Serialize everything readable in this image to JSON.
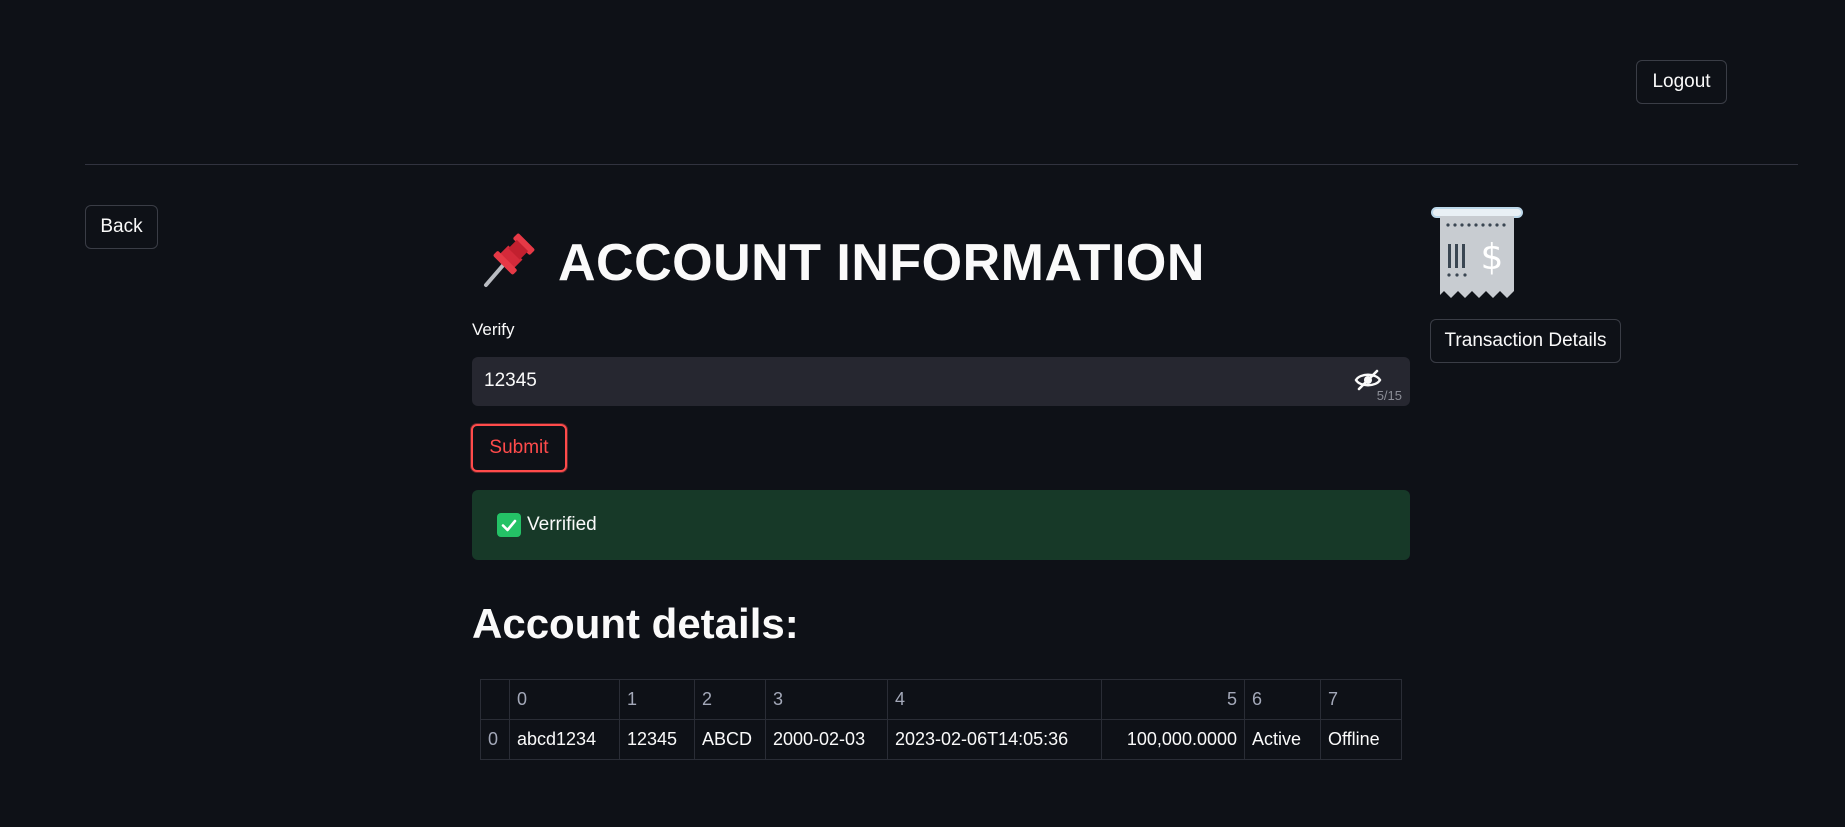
{
  "header": {
    "logout_label": "Logout"
  },
  "nav": {
    "back_label": "Back"
  },
  "page": {
    "title_icon": "pushpin-icon",
    "title": "ACCOUNT INFORMATION"
  },
  "sidebar_right": {
    "receipt_icon": "receipt-icon",
    "transaction_label": "Transaction Details"
  },
  "verify": {
    "label": "Verify",
    "value": "12345",
    "char_count": "5/15",
    "toggle_icon": "eye-slash-icon"
  },
  "submit_label": "Submit",
  "alert": {
    "icon": "check-box-icon",
    "text": "Verrified",
    "color": "#173928"
  },
  "details": {
    "heading": "Account details:",
    "columns": [
      "",
      "0",
      "1",
      "2",
      "3",
      "4",
      "5",
      "6",
      "7"
    ],
    "rows": [
      [
        "0",
        "abcd1234",
        "12345",
        "ABCD",
        "2000-02-03",
        "2023-02-06T14:05:36",
        "100,000.0000",
        "Active",
        "Offline"
      ]
    ]
  },
  "colors": {
    "background": "#0e1117",
    "accent": "#ff4b4b",
    "success": "#24c266"
  }
}
